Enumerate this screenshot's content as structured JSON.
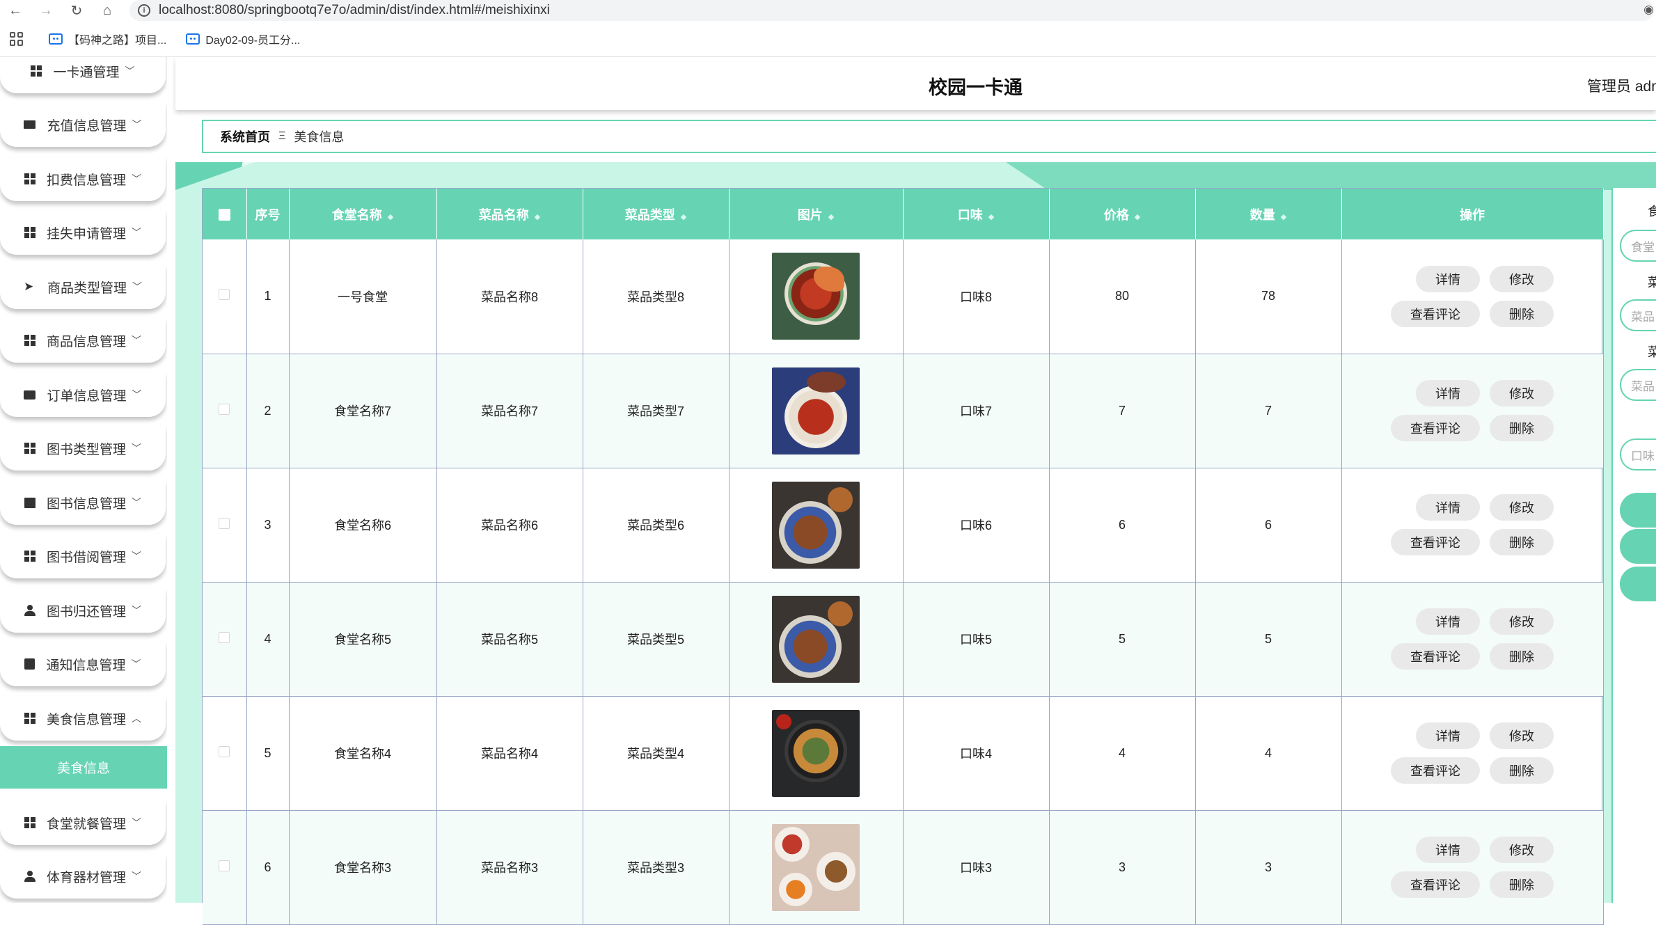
{
  "browser": {
    "url": "localhost:8080/springbootq7e7o/admin/dist/index.html#/meishixinxi",
    "bookmarks": [
      "【码神之路】项目...",
      "Day02-09-员工分..."
    ]
  },
  "header": {
    "title": "校园一卡通",
    "user": "管理员 adm"
  },
  "breadcrumb": {
    "home": "系统首页",
    "separator": "Ξ",
    "current": "美食信息"
  },
  "sidebar": {
    "items": [
      {
        "label": "一卡通管理",
        "icon": "grid-icon",
        "chevron": "﹀"
      },
      {
        "label": "充值信息管理",
        "icon": "monitor-icon",
        "chevron": "﹀"
      },
      {
        "label": "扣费信息管理",
        "icon": "grid-icon",
        "chevron": "﹀"
      },
      {
        "label": "挂失申请管理",
        "icon": "grid-icon",
        "chevron": "﹀"
      },
      {
        "label": "商品类型管理",
        "icon": "send-icon",
        "chevron": "﹀"
      },
      {
        "label": "商品信息管理",
        "icon": "grid-icon",
        "chevron": "﹀"
      },
      {
        "label": "订单信息管理",
        "icon": "briefcase-icon",
        "chevron": "﹀"
      },
      {
        "label": "图书类型管理",
        "icon": "grid-icon",
        "chevron": "﹀"
      },
      {
        "label": "图书信息管理",
        "icon": "book-icon",
        "chevron": "﹀"
      },
      {
        "label": "图书借阅管理",
        "icon": "grid-icon",
        "chevron": "﹀"
      },
      {
        "label": "图书归还管理",
        "icon": "user-icon",
        "chevron": "﹀"
      },
      {
        "label": "通知信息管理",
        "icon": "checklist-icon",
        "chevron": "﹀"
      },
      {
        "label": "美食信息管理",
        "icon": "grid-icon",
        "chevron": "︿"
      },
      {
        "label": "食堂就餐管理",
        "icon": "grid-icon",
        "chevron": "﹀"
      },
      {
        "label": "体育器材管理",
        "icon": "user-tie-icon",
        "chevron": "﹀"
      }
    ],
    "active_submenu": "美食信息"
  },
  "table": {
    "headers": [
      "序号",
      "食堂名称",
      "菜品名称",
      "菜品类型",
      "图片",
      "口味",
      "价格",
      "数量",
      "操作"
    ],
    "rows": [
      {
        "index": "1",
        "canteen": "一号食堂",
        "dish": "菜品名称8",
        "type": "菜品类型8",
        "taste": "口味8",
        "price": "80",
        "qty": "78"
      },
      {
        "index": "2",
        "canteen": "食堂名称7",
        "dish": "菜品名称7",
        "type": "菜品类型7",
        "taste": "口味7",
        "price": "7",
        "qty": "7"
      },
      {
        "index": "3",
        "canteen": "食堂名称6",
        "dish": "菜品名称6",
        "type": "菜品类型6",
        "taste": "口味6",
        "price": "6",
        "qty": "6"
      },
      {
        "index": "4",
        "canteen": "食堂名称5",
        "dish": "菜品名称5",
        "type": "菜品类型5",
        "taste": "口味5",
        "price": "5",
        "qty": "5"
      },
      {
        "index": "5",
        "canteen": "食堂名称4",
        "dish": "菜品名称4",
        "type": "菜品类型4",
        "taste": "口味4",
        "price": "4",
        "qty": "4"
      },
      {
        "index": "6",
        "canteen": "食堂名称3",
        "dish": "菜品名称3",
        "type": "菜品类型3",
        "taste": "口味3",
        "price": "3",
        "qty": "3"
      }
    ],
    "actions": {
      "detail": "详情",
      "edit": "修改",
      "view_comments": "查看评论",
      "delete": "删除"
    }
  },
  "search_panel": {
    "label_top": "食",
    "fields": [
      {
        "label": "菜",
        "placeholder": "食堂"
      },
      {
        "label": "菜",
        "placeholder": "菜品"
      },
      {
        "label": "",
        "placeholder": "菜品"
      },
      {
        "label": "",
        "placeholder": "口味"
      }
    ]
  },
  "colors": {
    "accent": "#66d4b3",
    "content_bg": "#c8f5e6",
    "button_bg": "#e9e9e9"
  }
}
